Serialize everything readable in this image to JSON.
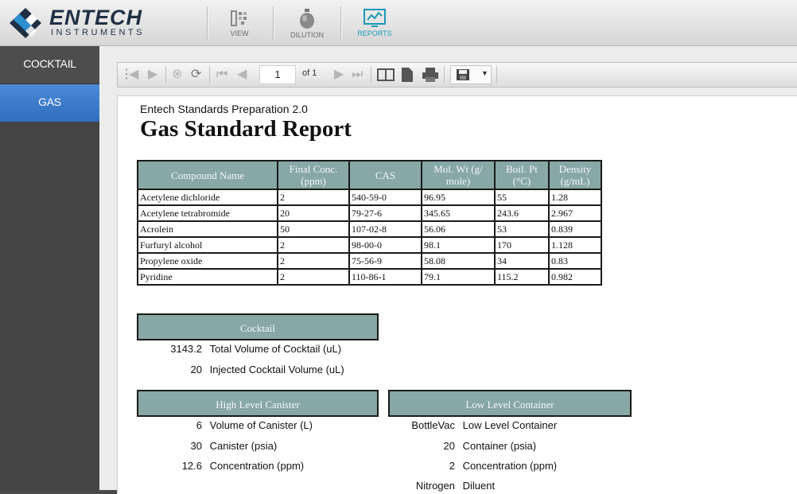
{
  "brand": {
    "name": "ENTECH",
    "sub": "INSTRUMENTS"
  },
  "header_buttons": [
    {
      "label": "VIEW",
      "icon": "view-icon"
    },
    {
      "label": "DILUTION",
      "icon": "canister-icon"
    },
    {
      "label": "REPORTS",
      "icon": "reports-icon",
      "active": true
    }
  ],
  "sidebar": {
    "items": [
      {
        "label": "COCKTAIL"
      },
      {
        "label": "GAS",
        "active": true
      }
    ]
  },
  "toolbar": {
    "page": "1",
    "of": "of 1"
  },
  "report": {
    "subtitle": "Entech Standards Preparation 2.0",
    "title": "Gas Standard Report",
    "columns": [
      "Compound Name",
      "Final Conc. (ppm)",
      "CAS",
      "Mol. Wt (g/ mole)",
      "Boil. Pt (°C)",
      "Density (g/mL)"
    ],
    "rows": [
      [
        "Acetylene dichloride",
        "2",
        "540-59-0",
        "96.95",
        "55",
        "1.28"
      ],
      [
        "Acetylene tetrabromide",
        "20",
        "79-27-6",
        "345.65",
        "243.6",
        "2.967"
      ],
      [
        "Acrolein",
        "50",
        "107-02-8",
        "56.06",
        "53",
        "0.839"
      ],
      [
        "Furfuryl alcohol",
        "2",
        "98-00-0",
        "98.1",
        "170",
        "1.128"
      ],
      [
        "Propylene oxide",
        "2",
        "75-56-9",
        "58.08",
        "34",
        "0.83"
      ],
      [
        "Pyridine",
        "2",
        "110-86-1",
        "79.1",
        "115.2",
        "0.982"
      ]
    ],
    "cocktail": {
      "title": "Cocktail",
      "rows": [
        {
          "value": "3143.2",
          "label": "Total Volume of Cocktail (uL)"
        },
        {
          "value": "20",
          "label": "Injected Cocktail Volume (uL)"
        }
      ]
    },
    "high": {
      "title": "High Level Canister",
      "rows": [
        {
          "value": "6",
          "label": "Volume of Canister (L)"
        },
        {
          "value": "30",
          "label": "Canister (psia)"
        },
        {
          "value": "12.6",
          "label": "Concentration (ppm)"
        }
      ]
    },
    "low": {
      "title": "Low Level Container",
      "rows": [
        {
          "value": "BottleVac",
          "label": "Low Level Container"
        },
        {
          "value": "20",
          "label": "Container (psia)"
        },
        {
          "value": "2",
          "label": "Concentration (ppm)"
        },
        {
          "value": "Nitrogen",
          "label": "Diluent"
        }
      ]
    }
  },
  "colors": {
    "accent": "#87a8a5",
    "nav_active": "#3a7bcb",
    "brand": "#1f2f44"
  }
}
